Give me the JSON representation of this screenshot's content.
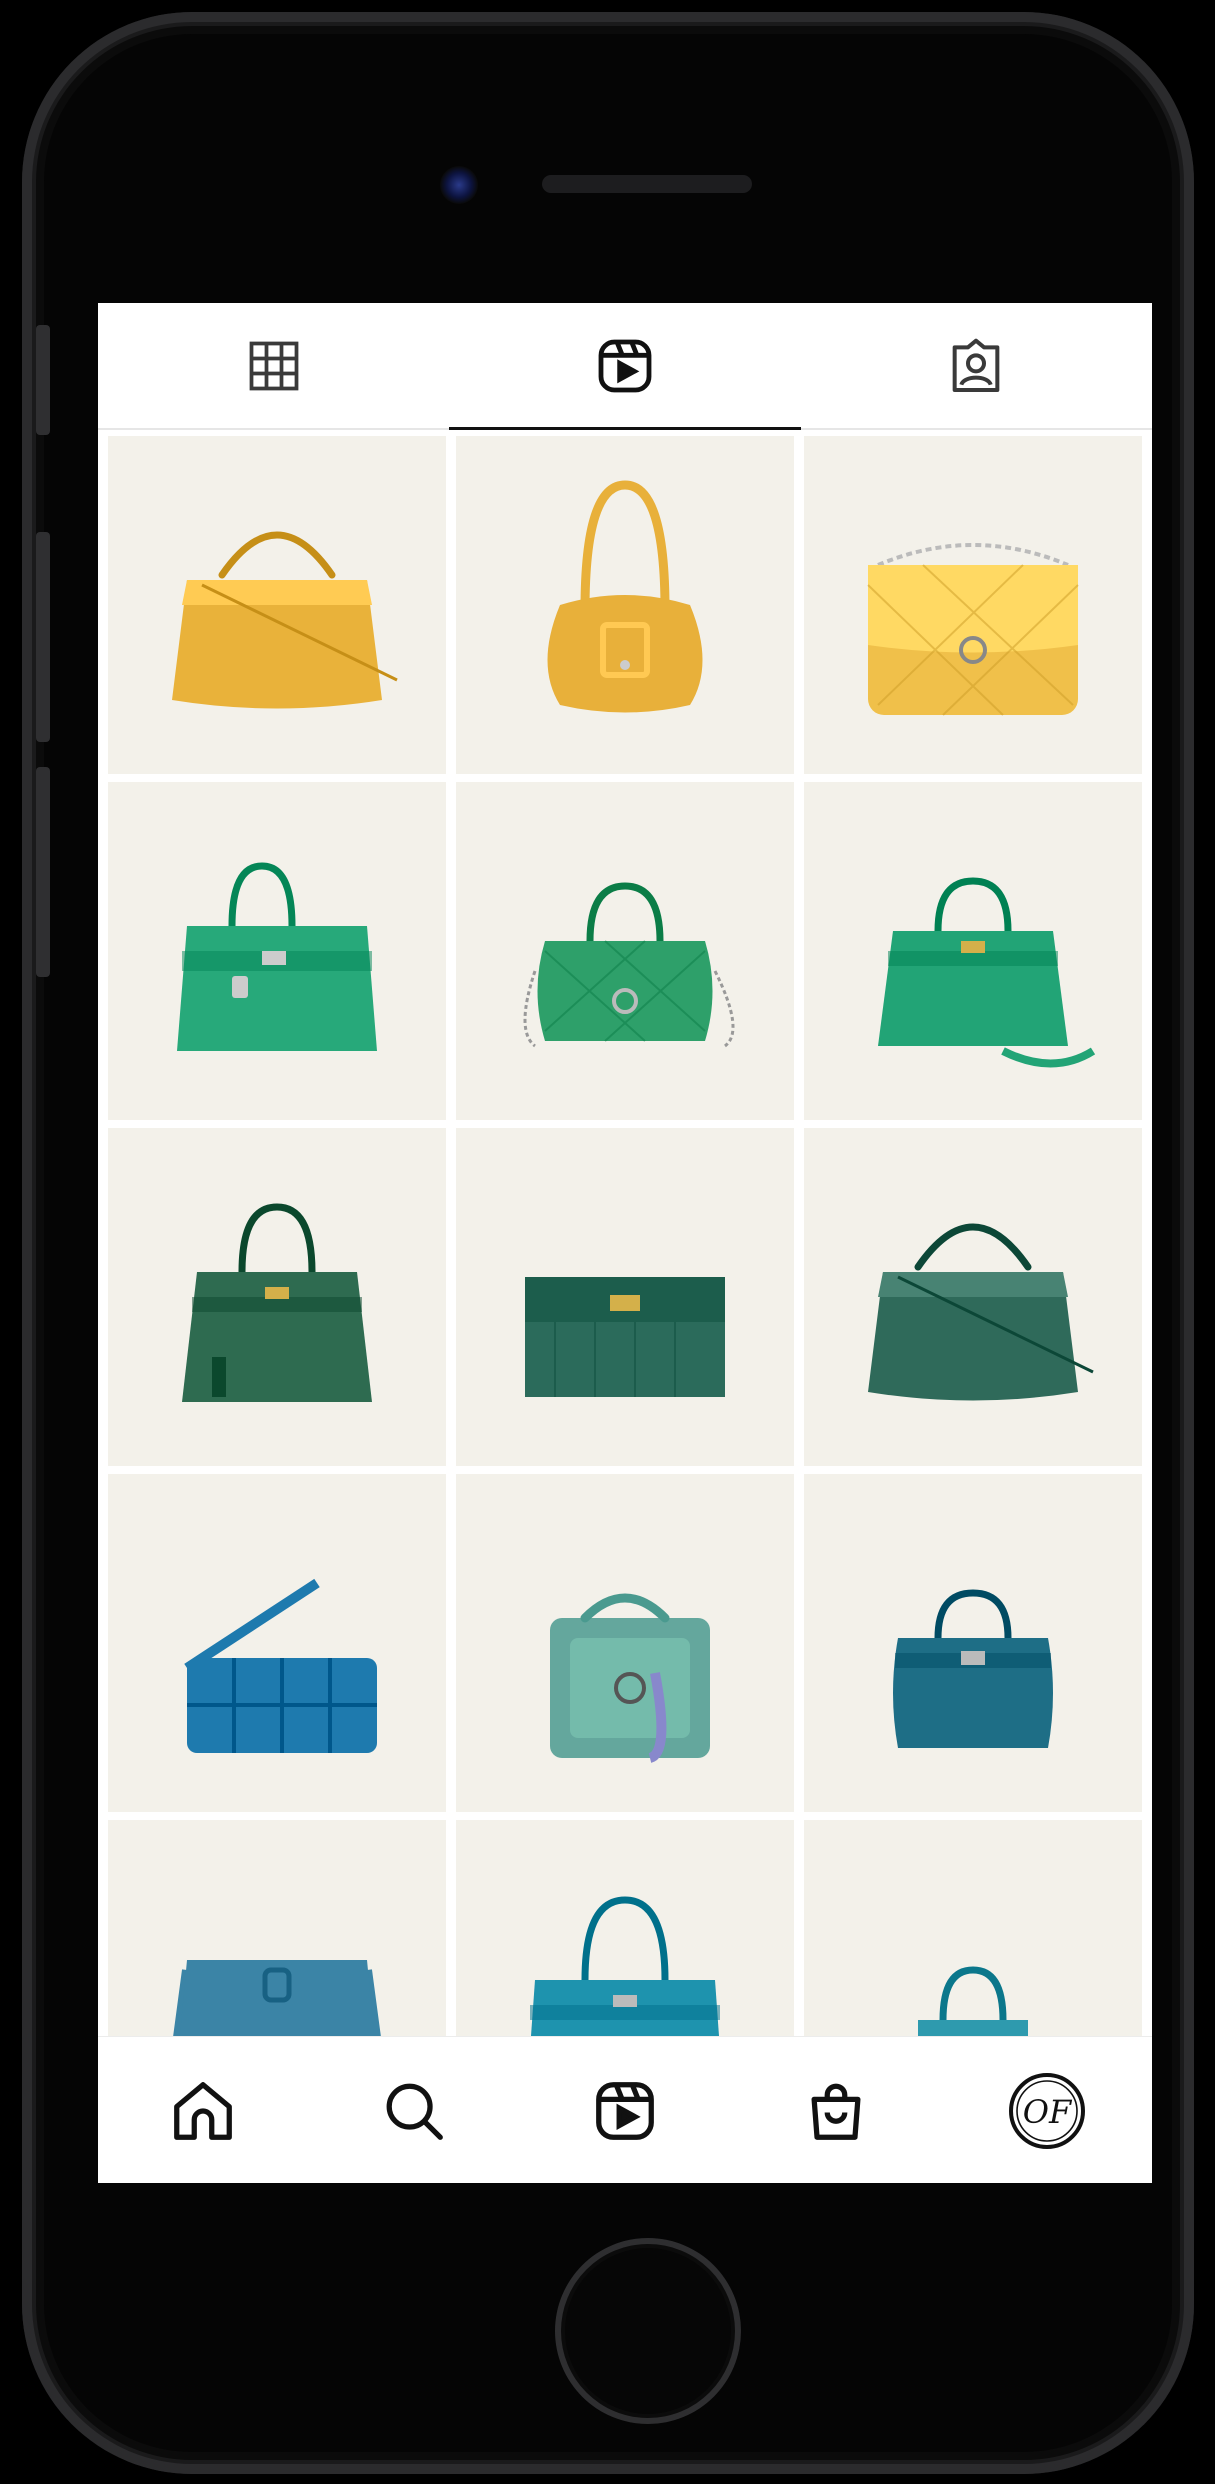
{
  "profile_tabs": [
    {
      "icon": "grid-icon",
      "active": false
    },
    {
      "icon": "reels-icon",
      "active": true
    },
    {
      "icon": "tagged-icon",
      "active": false
    }
  ],
  "posts": [
    {
      "color": "#E9B23A",
      "shape": "peekaboo"
    },
    {
      "color": "#E8B03A",
      "shape": "hobo"
    },
    {
      "color": "#F0C04A",
      "shape": "flap"
    },
    {
      "color": "#27A97A",
      "shape": "birkin"
    },
    {
      "color": "#2EA06A",
      "shape": "flap-top"
    },
    {
      "color": "#22A476",
      "shape": "kelly-mini"
    },
    {
      "color": "#2E6B50",
      "shape": "kelly"
    },
    {
      "color": "#2B6B5B",
      "shape": "clutch"
    },
    {
      "color": "#2F6A5A",
      "shape": "peekaboo"
    },
    {
      "color": "#1E7AAE",
      "shape": "cassette"
    },
    {
      "color": "#4A9A8F",
      "shape": "vanity"
    },
    {
      "color": "#1E6E86",
      "shape": "tote"
    },
    {
      "color": "#3B84A6",
      "shape": "evelyne"
    },
    {
      "color": "#1E93AE",
      "shape": "kelly-partial"
    },
    {
      "color": "#2E9AAE",
      "shape": "check-tote"
    }
  ],
  "bottom_nav": [
    {
      "icon": "home-icon"
    },
    {
      "icon": "search-icon"
    },
    {
      "icon": "reels-icon"
    },
    {
      "icon": "shop-icon"
    },
    {
      "icon": "profile-avatar"
    }
  ],
  "avatar_logo_text": "OF"
}
